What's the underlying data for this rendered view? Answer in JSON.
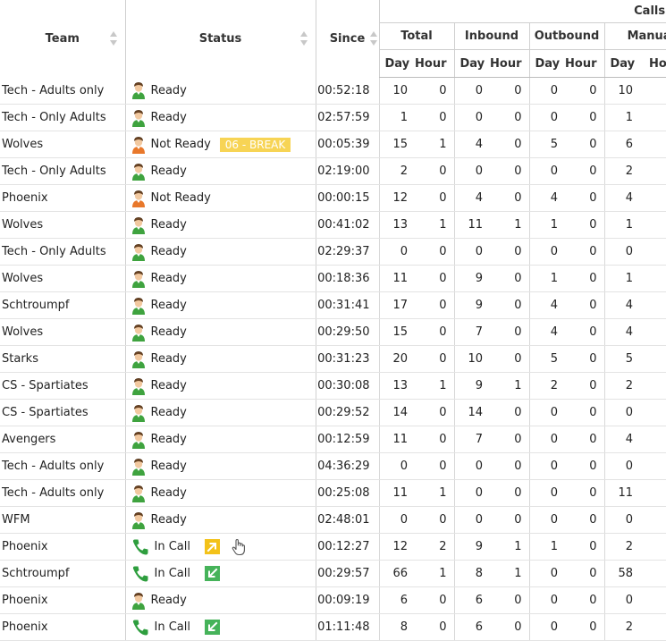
{
  "header": {
    "team": "Team",
    "status": "Status",
    "since": "Since",
    "calls": "Calls",
    "groups": [
      "Total",
      "Inbound",
      "Outbound",
      "Manual"
    ],
    "day": "Day",
    "hour": "Hour"
  },
  "colors": {
    "break_badge": "#f7d455",
    "ready_icon": "#3fa33f",
    "not_ready_icon": "#e8782b",
    "in_call_icon": "#2e9e3e",
    "outbound_badge": "#f3c21a",
    "inbound_badge": "#46b35a"
  },
  "rows": [
    {
      "team": "Tech - Adults only",
      "status": "Ready",
      "since": "00:52:18",
      "stats": [
        "10",
        "0",
        "0",
        "0",
        "0",
        "0",
        "10",
        ""
      ]
    },
    {
      "team": "Tech - Only Adults",
      "status": "Ready",
      "since": "02:57:59",
      "stats": [
        "1",
        "0",
        "0",
        "0",
        "0",
        "0",
        "1",
        ""
      ]
    },
    {
      "team": "Wolves",
      "status": "Not Ready",
      "badge": "06 - BREAK",
      "since": "00:05:39",
      "stats": [
        "15",
        "1",
        "4",
        "0",
        "5",
        "0",
        "6",
        ""
      ]
    },
    {
      "team": "Tech - Only Adults",
      "status": "Ready",
      "since": "02:19:00",
      "stats": [
        "2",
        "0",
        "0",
        "0",
        "0",
        "0",
        "2",
        ""
      ]
    },
    {
      "team": "Phoenix",
      "status": "Not Ready",
      "since": "00:00:15",
      "stats": [
        "12",
        "0",
        "4",
        "0",
        "4",
        "0",
        "4",
        ""
      ]
    },
    {
      "team": "Wolves",
      "status": "Ready",
      "since": "00:41:02",
      "stats": [
        "13",
        "1",
        "11",
        "1",
        "1",
        "0",
        "1",
        ""
      ]
    },
    {
      "team": "Tech - Only Adults",
      "status": "Ready",
      "since": "02:29:37",
      "stats": [
        "0",
        "0",
        "0",
        "0",
        "0",
        "0",
        "0",
        ""
      ]
    },
    {
      "team": "Wolves",
      "status": "Ready",
      "since": "00:18:36",
      "stats": [
        "11",
        "0",
        "9",
        "0",
        "1",
        "0",
        "1",
        ""
      ]
    },
    {
      "team": "Schtroumpf",
      "status": "Ready",
      "since": "00:31:41",
      "stats": [
        "17",
        "0",
        "9",
        "0",
        "4",
        "0",
        "4",
        ""
      ]
    },
    {
      "team": "Wolves",
      "status": "Ready",
      "since": "00:29:50",
      "stats": [
        "15",
        "0",
        "7",
        "0",
        "4",
        "0",
        "4",
        ""
      ]
    },
    {
      "team": "Starks",
      "status": "Ready",
      "since": "00:31:23",
      "stats": [
        "20",
        "0",
        "10",
        "0",
        "5",
        "0",
        "5",
        ""
      ]
    },
    {
      "team": "CS - Spartiates",
      "status": "Ready",
      "since": "00:30:08",
      "stats": [
        "13",
        "1",
        "9",
        "1",
        "2",
        "0",
        "2",
        ""
      ]
    },
    {
      "team": "CS - Spartiates",
      "status": "Ready",
      "since": "00:29:52",
      "stats": [
        "14",
        "0",
        "14",
        "0",
        "0",
        "0",
        "0",
        ""
      ]
    },
    {
      "team": "Avengers",
      "status": "Ready",
      "since": "00:12:59",
      "stats": [
        "11",
        "0",
        "7",
        "0",
        "0",
        "0",
        "4",
        ""
      ]
    },
    {
      "team": "Tech - Adults only",
      "status": "Ready",
      "since": "04:36:29",
      "stats": [
        "0",
        "0",
        "0",
        "0",
        "0",
        "0",
        "0",
        ""
      ]
    },
    {
      "team": "Tech - Adults only",
      "status": "Ready",
      "since": "00:25:08",
      "stats": [
        "11",
        "1",
        "0",
        "0",
        "0",
        "0",
        "11",
        ""
      ]
    },
    {
      "team": "WFM",
      "status": "Ready",
      "since": "02:48:01",
      "stats": [
        "0",
        "0",
        "0",
        "0",
        "0",
        "0",
        "0",
        ""
      ]
    },
    {
      "team": "Phoenix",
      "status": "In Call",
      "direction": "outbound",
      "hand": true,
      "since": "00:12:27",
      "stats": [
        "12",
        "2",
        "9",
        "1",
        "1",
        "0",
        "2",
        ""
      ]
    },
    {
      "team": "Schtroumpf",
      "status": "In Call",
      "direction": "inbound",
      "since": "00:29:57",
      "stats": [
        "66",
        "1",
        "8",
        "1",
        "0",
        "0",
        "58",
        ""
      ]
    },
    {
      "team": "Phoenix",
      "status": "Ready",
      "since": "00:09:19",
      "stats": [
        "6",
        "0",
        "6",
        "0",
        "0",
        "0",
        "0",
        ""
      ]
    },
    {
      "team": "Phoenix",
      "status": "In Call",
      "direction": "inbound",
      "since": "01:11:48",
      "stats": [
        "8",
        "0",
        "6",
        "0",
        "0",
        "0",
        "2",
        ""
      ]
    }
  ]
}
